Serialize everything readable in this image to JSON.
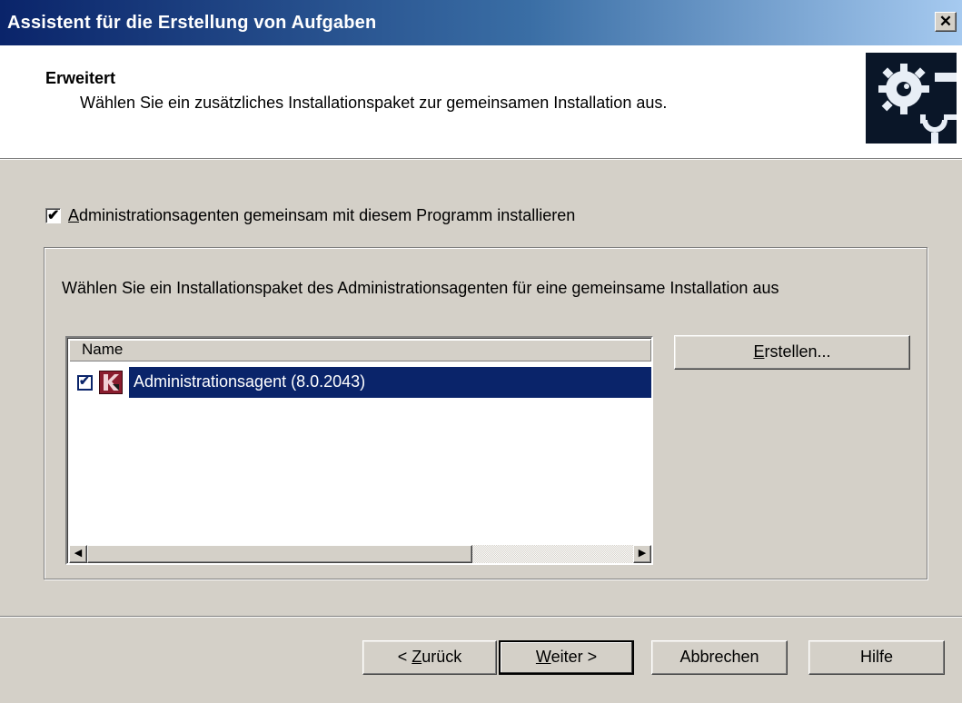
{
  "window": {
    "title": "Assistent für die Erstellung von Aufgaben",
    "close_glyph": "✕"
  },
  "header": {
    "title": "Erweitert",
    "subtitle": "Wählen Sie ein zusätzliches Installationspaket zur gemeinsamen Installation aus.",
    "icon": "settings-gears-icon"
  },
  "agent_option": {
    "checked": true,
    "label_accesskey": "A",
    "label_rest": "dministrationsagenten gemeinsam mit diesem Programm installieren"
  },
  "group": {
    "description": "Wählen Sie ein Installationspaket des Administrationsagenten für eine gemeinsame Installation aus"
  },
  "list": {
    "columns": [
      "Name"
    ],
    "rows": [
      {
        "checked": true,
        "icon": "kaspersky-k-icon",
        "name": "Administrationsagent (8.0.2043)",
        "selected": true
      }
    ]
  },
  "create_button": {
    "accesskey": "E",
    "rest": "rstellen..."
  },
  "buttons": {
    "back": {
      "prefix": "< ",
      "accesskey": "Z",
      "rest": "urück"
    },
    "next": {
      "accesskey": "W",
      "rest": "eiter >"
    },
    "cancel": "Abbrechen",
    "help": "Hilfe"
  }
}
